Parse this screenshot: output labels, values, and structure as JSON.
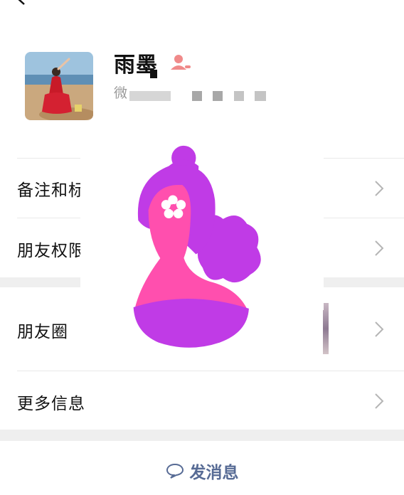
{
  "profile": {
    "name": "雨墨",
    "wechat_id_prefix": "微"
  },
  "rows": [
    {
      "label": "备注和标签"
    },
    {
      "label": "朋友权限"
    },
    {
      "label": "朋友圈"
    },
    {
      "label": "更多信息"
    }
  ],
  "actions": {
    "send_message": "发消息"
  },
  "icons": {
    "back": "chevron-left-icon",
    "gender": "female-user-icon",
    "row_arrow": "chevron-right-icon",
    "send": "chat-bubble-icon",
    "overlay": "pink-woman-logo"
  },
  "colors": {
    "link_blue": "#576b95",
    "overlay_pink": "#ff4fae",
    "overlay_purple": "#c03be6",
    "gender_pink": "#f08a8a"
  }
}
